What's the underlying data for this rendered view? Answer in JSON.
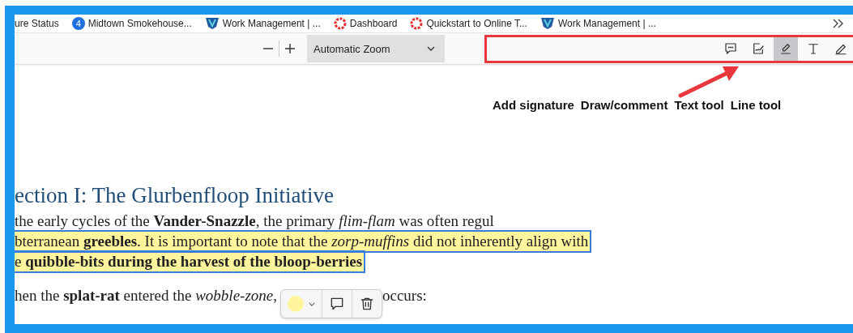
{
  "bookmarks": [
    {
      "kind": "plain",
      "label": "ure Status"
    },
    {
      "kind": "badge",
      "badge": "4",
      "label": "Midtown Smokehouse..."
    },
    {
      "kind": "shield",
      "label": "Work Management | ..."
    },
    {
      "kind": "ring",
      "label": "Dashboard"
    },
    {
      "kind": "ring",
      "label": "Quickstart to Online T..."
    },
    {
      "kind": "shield",
      "label": "Work Management | ..."
    }
  ],
  "toolbar": {
    "zoom": "Automatic Zoom",
    "tools": [
      {
        "kind": "comment",
        "selected": false
      },
      {
        "kind": "signature",
        "selected": false
      },
      {
        "kind": "highlight",
        "selected": true
      },
      {
        "kind": "text",
        "selected": false
      },
      {
        "kind": "draw",
        "selected": false
      }
    ]
  },
  "callouts": [
    "Add signature",
    "Draw/comment",
    "Text tool",
    "Line tool"
  ],
  "document": {
    "heading": "ection I: The Glurbenfloop Initiative",
    "lines": [
      {
        "text": "the early cycles of the **Vander-Snazzle**, the primary *flim-flam* was often regul",
        "highlighted": false
      },
      {
        "text": "bterranean **greebles**. It is important to note that the *zorp-muffins* did not inherently align with",
        "highlighted": true
      },
      {
        "text": "e **quibble-bits during the harvest of the bloop-berries**",
        "highlighted": true
      }
    ],
    "last_line": {
      "before": "hen the **splat-rat** entered the *wobble-zone*,",
      "after": "occurs:"
    },
    "popup": {
      "color": "#fff59d"
    }
  }
}
